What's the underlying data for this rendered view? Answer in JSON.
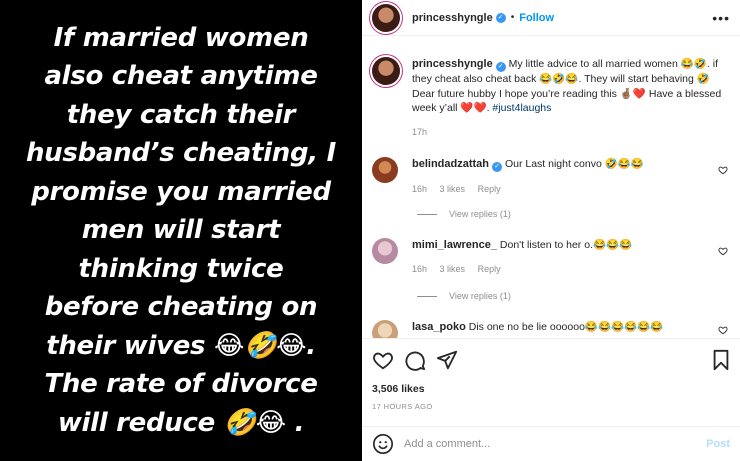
{
  "media": {
    "lines": [
      "If married women",
      "also  cheat anytime",
      "they catch their",
      "husband’s cheating, I",
      "promise you married",
      "men will start",
      "thinking twice",
      "before cheating on",
      "their wives 😂🤣😂.",
      "The rate of divorce",
      "will reduce 🤣😂 ."
    ]
  },
  "header": {
    "username": "princesshyngle",
    "dot": "•",
    "follow_label": "Follow",
    "more_label": "•••"
  },
  "caption": {
    "username": "princesshyngle",
    "text": "My little advice to all married women 😂🤣. if they cheat also cheat back 😂🤣😂. They will start behaving 🤣 Dear future hubby I hope you’re reading this 🤞🏽❤️ Have a blessed week y’all ❤️❤️. ",
    "hashtag": "#just4laughs",
    "time": "17h"
  },
  "comments": [
    {
      "username": "belindadzattah",
      "text": "Our Last night convo 🤣😂😂",
      "time": "16h",
      "likes": "3 likes",
      "reply": "Reply",
      "view_replies": "View replies (1)"
    },
    {
      "username": "mimi_lawrence_",
      "text": "Don't listen to her o.😂😂😂",
      "time": "16h",
      "likes": "3 likes",
      "reply": "Reply",
      "view_replies": "View replies (1)"
    },
    {
      "username": "lasa_poko",
      "text": "Dis one no be lie oooooo😂😂😂😂😂😂"
    }
  ],
  "footer": {
    "likes": "3,506 likes",
    "ago": "17 HOURS AGO",
    "comment_placeholder": "Add a comment...",
    "post_label": "Post"
  },
  "colors": {
    "accent": "#0095f6",
    "verified": "#3897f0",
    "post_disabled": "#b2dffc"
  }
}
